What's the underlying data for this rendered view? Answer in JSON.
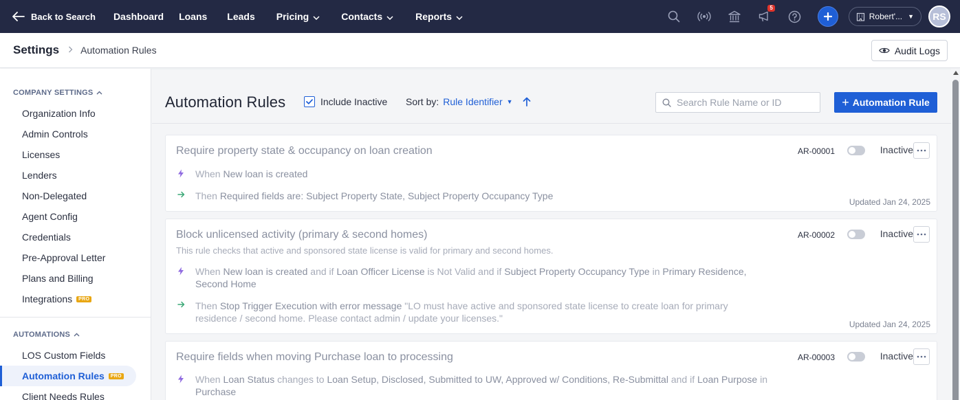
{
  "topnav": {
    "back_label": "Back to Search",
    "items": [
      {
        "label": "Dashboard",
        "dropdown": false
      },
      {
        "label": "Loans",
        "dropdown": false
      },
      {
        "label": "Leads",
        "dropdown": false
      },
      {
        "label": "Pricing",
        "dropdown": true
      },
      {
        "label": "Contacts",
        "dropdown": true
      },
      {
        "label": "Reports",
        "dropdown": true
      }
    ],
    "notification_count": "5",
    "org_label": "Robert'...",
    "avatar_initials": "RS",
    "icons": [
      "search-icon",
      "broadcast-icon",
      "bank-icon",
      "announcement-icon",
      "help-icon",
      "plus-icon"
    ]
  },
  "header": {
    "root": "Settings",
    "page": "Automation Rules",
    "audit_label": "Audit Logs"
  },
  "sidebar": {
    "company_heading": "COMPANY SETTINGS",
    "company_items": [
      {
        "label": "Organization Info"
      },
      {
        "label": "Admin Controls"
      },
      {
        "label": "Licenses"
      },
      {
        "label": "Lenders"
      },
      {
        "label": "Non-Delegated"
      },
      {
        "label": "Agent Config"
      },
      {
        "label": "Credentials"
      },
      {
        "label": "Pre-Approval Letter"
      },
      {
        "label": "Plans and Billing"
      },
      {
        "label": "Integrations",
        "badge": "PRO"
      }
    ],
    "automations_heading": "AUTOMATIONS",
    "automation_items": [
      {
        "label": "LOS Custom Fields"
      },
      {
        "label": "Automation Rules",
        "badge": "PRO",
        "active": true
      },
      {
        "label": "Client Needs Rules"
      }
    ]
  },
  "toolbar": {
    "title": "Automation Rules",
    "include_inactive_label": "Include Inactive",
    "include_inactive_checked": true,
    "sort_label": "Sort by:",
    "sort_value": "Rule Identifier",
    "search_placeholder": "Search Rule Name or ID",
    "add_label": "Automation Rule"
  },
  "rules": [
    {
      "title": "Require property state & occupancy on loan creation",
      "description": "",
      "id": "AR-00001",
      "status": "Inactive",
      "updated": "Updated Jan 24, 2025",
      "when": [
        [
          "When ",
          ""
        ],
        [
          "New loan is created",
          "b"
        ]
      ],
      "then": [
        [
          "Then ",
          ""
        ],
        [
          "Required fields are: Subject Property State, Subject Property Occupancy Type",
          "b"
        ]
      ]
    },
    {
      "title": "Block unlicensed activity (primary & second homes)",
      "description": "This rule checks that active and sponsored state license is valid for primary and second homes.",
      "id": "AR-00002",
      "status": "Inactive",
      "updated": "Updated Jan 24, 2025",
      "when": [
        [
          "When ",
          ""
        ],
        [
          "New loan is created",
          "b"
        ],
        [
          " and if ",
          ""
        ],
        [
          "Loan Officer License",
          "b"
        ],
        [
          " is Not Valid and if ",
          ""
        ],
        [
          "Subject Property Occupancy Type",
          "b"
        ],
        [
          " in ",
          ""
        ],
        [
          "Primary Residence, Second Home",
          "b"
        ]
      ],
      "then": [
        [
          "Then ",
          ""
        ],
        [
          "Stop Trigger Execution with error message",
          "b"
        ],
        [
          " \"LO must have active and sponsored state license to create loan for primary residence / second home. Please contact admin / update your licenses.\"",
          ""
        ]
      ]
    },
    {
      "title": "Require fields when moving Purchase loan to processing",
      "description": "",
      "id": "AR-00003",
      "status": "Inactive",
      "updated": "",
      "when": [
        [
          "When ",
          ""
        ],
        [
          "Loan Status",
          "b"
        ],
        [
          " changes to ",
          ""
        ],
        [
          "Loan Setup, Disclosed, Submitted to UW, Approved w/ Conditions, Re-Submittal",
          "b"
        ],
        [
          " and if ",
          ""
        ],
        [
          "Loan Purpose",
          "b"
        ],
        [
          " in ",
          ""
        ],
        [
          "Purchase",
          "b"
        ]
      ],
      "then": []
    }
  ],
  "colors": {
    "nav_bg": "#232944",
    "accent": "#1f5fd6",
    "pro_badge": "#e9a713"
  }
}
